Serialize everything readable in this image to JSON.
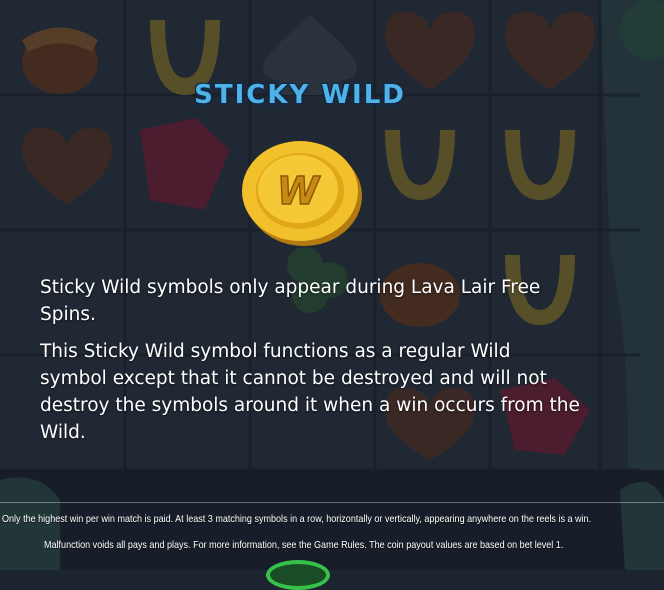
{
  "popup": {
    "title": "STICKY WILD",
    "coin_letter": "W",
    "paragraph_1": "Sticky Wild symbols only appear during Lava Lair Free Spins.",
    "paragraph_2": "This Sticky Wild symbol functions as a regular Wild symbol except that it cannot be destroyed and will not destroy the symbols around it when a win occurs from the Wild."
  },
  "footer": {
    "line_1": "Only the highest win per win match is paid. At least 3 matching symbols in a row, horizontally or vertically, appearing anywhere on the reels is a win.",
    "line_2": "Malfunction voids all pays and plays. For more information, see the Game Rules. The coin payout values are based on bet level 1."
  },
  "colors": {
    "title": "#4fb3e8",
    "coin": "#f2c02a",
    "button": "#36c24a"
  },
  "icons": [
    "acorn-icon",
    "horseshoe-icon",
    "heart-icon",
    "spade-icon",
    "gem-icon",
    "clover-icon",
    "gold-coin-wild-icon"
  ]
}
